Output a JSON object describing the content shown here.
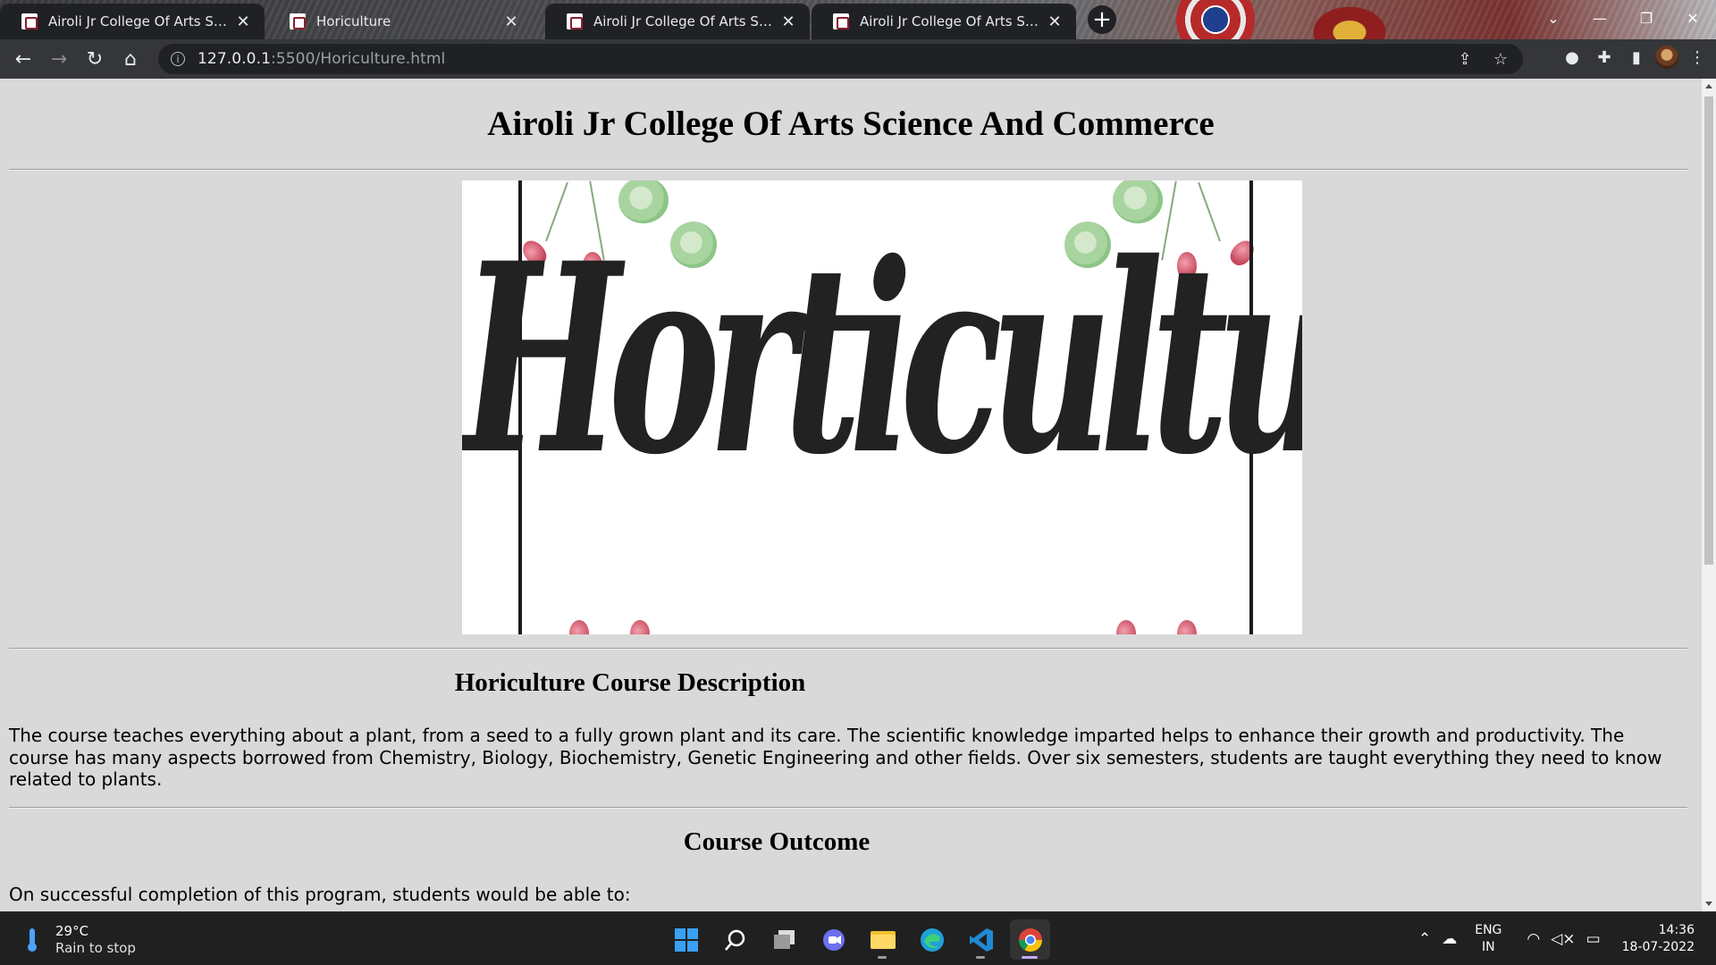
{
  "browser": {
    "tabs": [
      {
        "title": "Airoli Jr College Of Arts Science And Commerce",
        "state": "inactive"
      },
      {
        "title": "Horiculture",
        "state": "active"
      },
      {
        "title": "Airoli Jr College Of Arts Science And Commerce",
        "state": "inactive"
      },
      {
        "title": "Airoli Jr College Of Arts Science And Commerce",
        "state": "inactive"
      }
    ],
    "new_tab_symbol": "+",
    "url_host": "127.0.0.1",
    "url_path": ":5500/Horiculture.html",
    "icons": [
      "back-icon",
      "forward-icon",
      "reload-icon",
      "home-icon",
      "info-icon",
      "share-icon",
      "star-icon",
      "extension-icon",
      "puzzle-icon",
      "sidepanel-icon",
      "profile-avatar",
      "menu-icon"
    ]
  },
  "page": {
    "heading": "Airoli Jr College Of Arts Science And Commerce",
    "hero_word": "Horticulture",
    "sections": [
      {
        "title": "Horiculture Course Description",
        "body": "The course teaches everything about a plant, from a seed to a fully grown plant and its care. The scientific knowledge imparted helps to enhance their growth and productivity. The course has many aspects borrowed from Chemistry, Biology, Biochemistry, Genetic Engineering and other fields. Over six semesters, students are taught everything they need to know related to plants."
      },
      {
        "title": "Course Outcome",
        "body": "On successful completion of this program, students would be able to:"
      }
    ]
  },
  "taskbar": {
    "weather_temp": "29°C",
    "weather_desc": "Rain to stop",
    "apps": [
      "windows-start",
      "search",
      "task-view",
      "chat",
      "file-explorer",
      "edge",
      "vscode",
      "chrome"
    ],
    "lang_top": "ENG",
    "lang_bottom": "IN",
    "time": "14:36",
    "date": "18-07-2022"
  },
  "colors": {
    "page_bg": "#d9d9d9",
    "tab_dark": "#202124",
    "toolbar": "#35363a",
    "taskbar": "#202020"
  }
}
